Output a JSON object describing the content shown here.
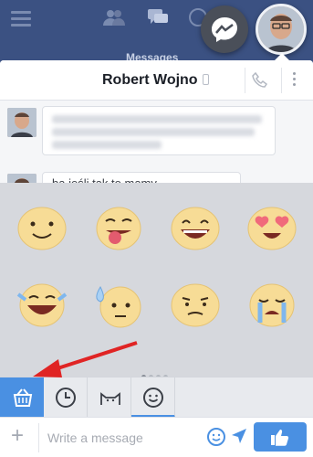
{
  "topbar": {
    "tab_label": "Messages"
  },
  "chat": {
    "contact_name": "Robert Wojno",
    "messages": [
      {
        "visible_text": ""
      },
      {
        "visible_text": "ba jeśli tak to mamy"
      }
    ]
  },
  "stickers": {
    "items": [
      "smile-sticker",
      "tongue-sticker",
      "grin-sticker",
      "heart-eyes-sticker",
      "tears-of-joy-sticker",
      "sweat-sticker",
      "confused-sticker",
      "crying-sticker"
    ],
    "page_count": 4,
    "active_page": 1
  },
  "sticker_tabs": [
    "sticker-store",
    "recent",
    "cat-sticker-pack",
    "emoji-sticker-pack"
  ],
  "composer": {
    "placeholder": "Write a message"
  },
  "colors": {
    "accent": "#4a90e2",
    "header": "#3b5182",
    "annotation_arrow": "#e02424"
  }
}
